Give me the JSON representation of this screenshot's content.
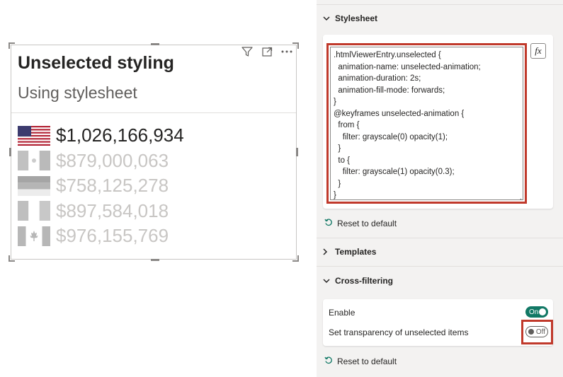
{
  "visual": {
    "title": "Unselected styling",
    "subtitle": "Using stylesheet",
    "header_icons": [
      "filter-icon",
      "focus-mode-icon",
      "more-options-icon"
    ],
    "entries": [
      {
        "flag": "united-states-flag",
        "amount": "$1,026,166,934",
        "state": "selected"
      },
      {
        "flag": "mexico-flag",
        "amount": "$879,000,063",
        "state": "unselected"
      },
      {
        "flag": "germany-flag",
        "amount": "$758,125,278",
        "state": "unselected"
      },
      {
        "flag": "france-flag",
        "amount": "$897,584,018",
        "state": "unselected"
      },
      {
        "flag": "canada-flag",
        "amount": "$976,155,769",
        "state": "unselected"
      }
    ]
  },
  "pane": {
    "stylesheet": {
      "header": "Stylesheet",
      "code": ".htmlViewerEntry.unselected {\n  animation-name: unselected-animation;\n  animation-duration: 2s;\n  animation-fill-mode: forwards;\n}\n@keyframes unselected-animation {\n  from {\n    filter: grayscale(0) opacity(1);\n  }\n  to {\n    filter: grayscale(1) opacity(0.3);\n  }\n}",
      "fx_label": "fx",
      "reset_label": "Reset to default"
    },
    "templates": {
      "header": "Templates"
    },
    "cross_filtering": {
      "header": "Cross-filtering",
      "enable_label": "Enable",
      "enable_toggle": "On",
      "transparency_label": "Set transparency of unselected items",
      "transparency_toggle": "Off",
      "reset_label": "Reset to default"
    }
  },
  "colors": {
    "toggle_on": "#117865",
    "highlight": "#c0392b",
    "selected_text": "#252423",
    "unselected_text": "#c8c6c4"
  }
}
